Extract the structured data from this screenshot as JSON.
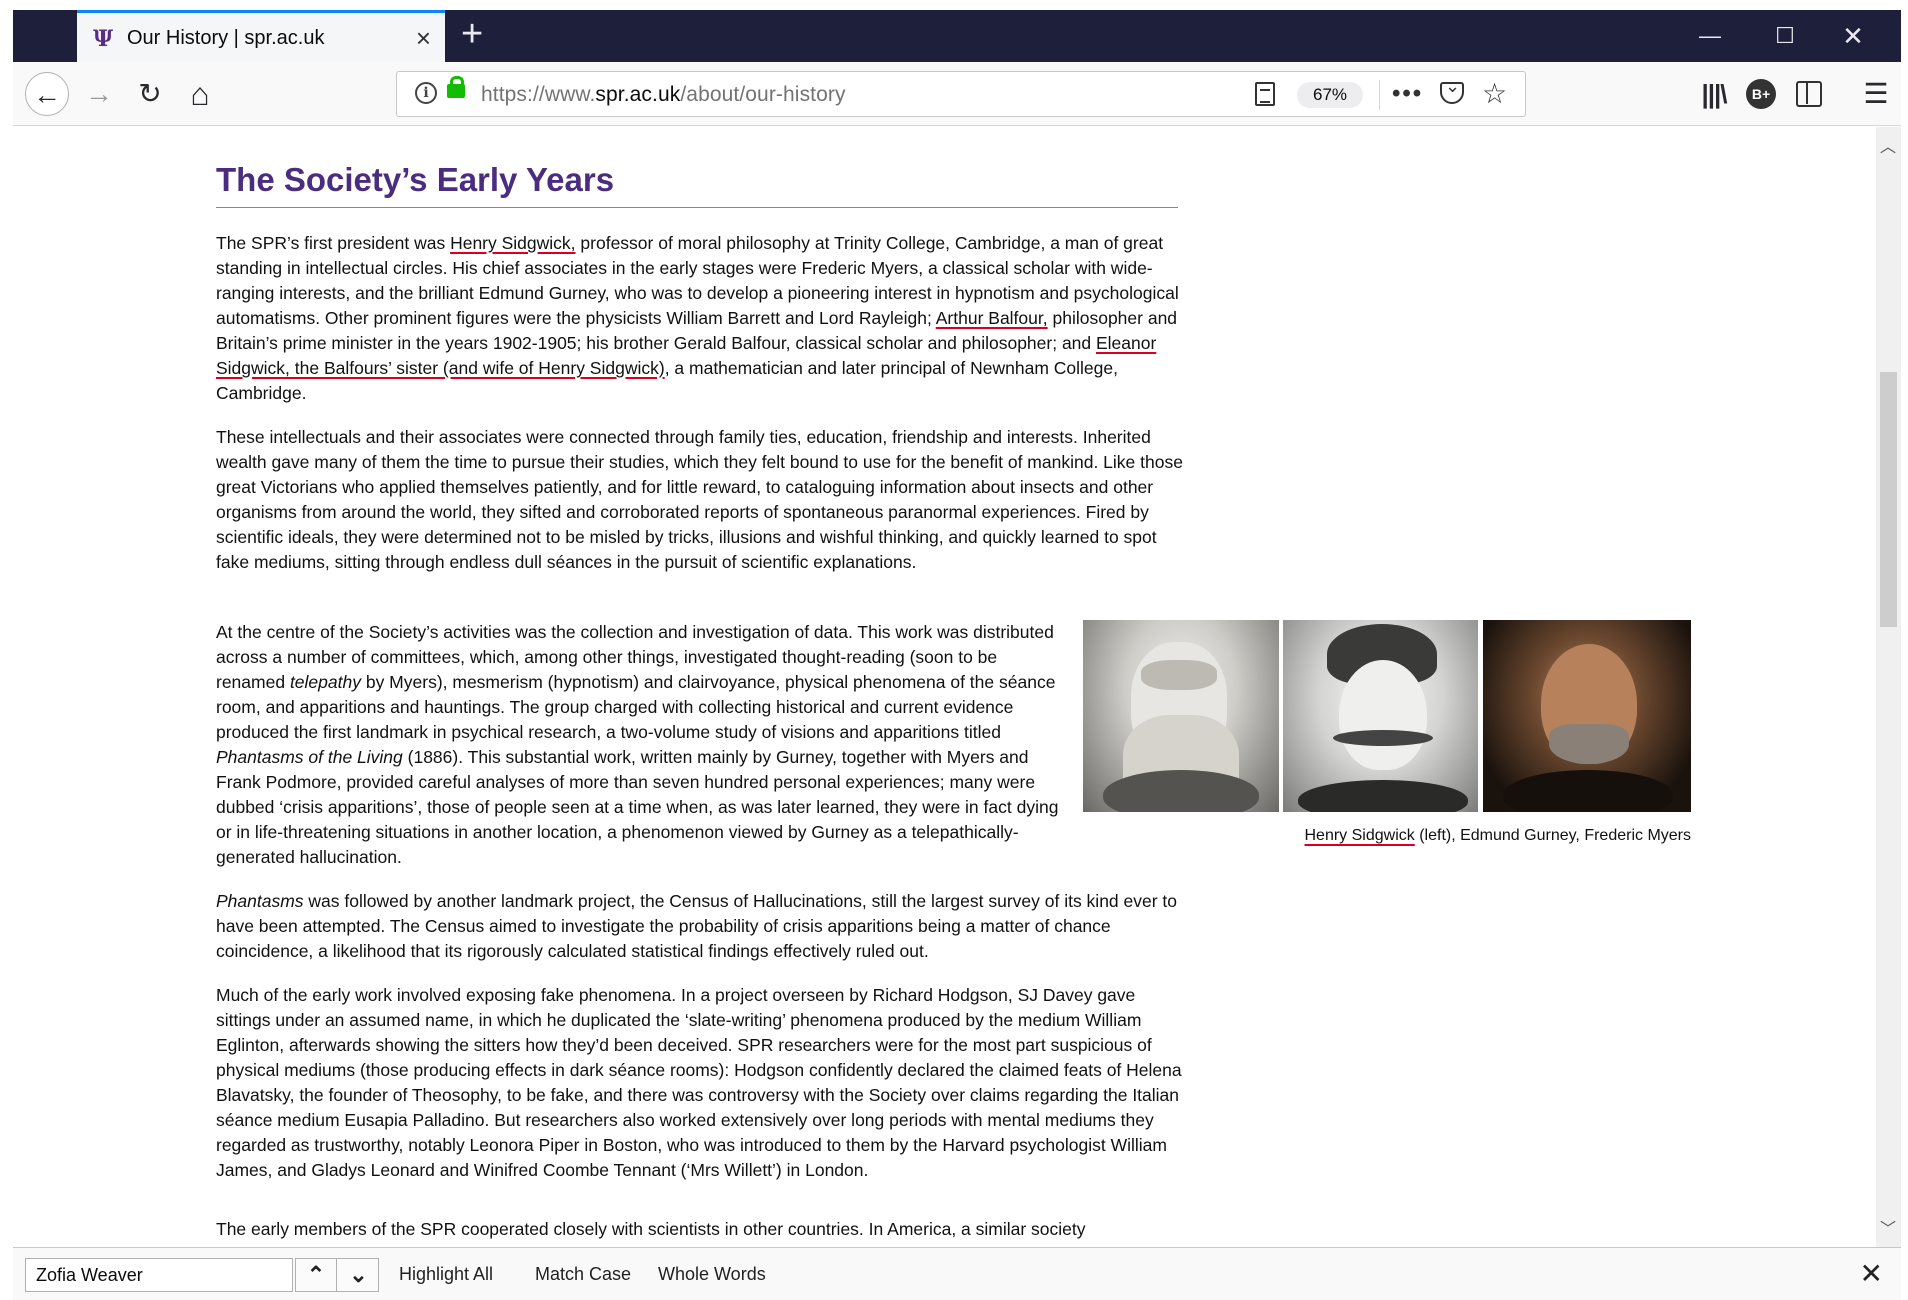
{
  "browser": {
    "tab": {
      "title": "Our History | spr.ac.uk",
      "favicon": "spr-psi-logo"
    },
    "window_controls": {
      "minimize": "—",
      "maximize": "☐",
      "close": "✕"
    },
    "nav": {
      "back": "←",
      "forward": "→",
      "reload": "↻",
      "home": "⌂"
    },
    "url": {
      "prefix": "https://www.",
      "domain": "spr.ac.uk",
      "path": "/about/our-history"
    },
    "zoom": "67%",
    "page_actions": "•••",
    "star": "☆",
    "toolbar": {
      "library": "|||\\",
      "extension": "B+",
      "menu": "☰"
    }
  },
  "article": {
    "heading": "The Society’s Early Years",
    "p1": {
      "t1": "The SPR’s first president was ",
      "link1": "Henry Sidgwick,",
      "t2": " professor of moral philosophy at Trinity College, Cambridge, a man of great standing in intellectual circles. His chief associates in the early stages were Frederic Myers, a classical scholar with wide-ranging interests, and the brilliant Edmund Gurney, who was to develop a pioneering interest in hypnotism and psychological automatisms.  Other prominent figures were the physicists William Barrett and Lord Rayleigh; ",
      "link2": "Arthur Balfour,",
      "t3": " philosopher and Britain’s prime minister in the years 1902-1905; his brother Gerald Balfour, classical scholar and philosopher; and ",
      "link3": "Eleanor Sidgwick, the Balfours’ sister (and wife of Henry Sidgwick)",
      "t4": ", a mathematician and later principal of Newnham College, Cambridge."
    },
    "p2": "These intellectuals and their associates were connected through family ties, education, friendship and interests. Inherited wealth gave many of them the time to pursue their studies, which they felt bound to use for the benefit of mankind. Like those great Victorians who applied themselves patiently, and for little reward, to cataloguing information about insects and other organisms from around the world, they sifted and corroborated reports of spontaneous paranormal experiences. Fired by scientific ideals, they were determined not to be misled by tricks, illusions and wishful thinking, and quickly learned to spot fake mediums, sitting through endless dull séances in the pursuit of scientific explanations.",
    "p3": {
      "t1": "At the centre of the Society’s activities was the collection and investigation of data. This work was distributed across a number of committees, which, among other things, investigated thought-reading (soon to be renamed ",
      "em1": "telepathy",
      "t2": " by Myers), mesmerism (hypnotism) and clairvoyance, physical phenomena of the séance room, and apparitions and hauntings. The group charged with collecting historical and current evidence produced the first landmark in psychical research, a two-volume study of visions and apparitions titled ",
      "em2": "Phantasms of the Living",
      "t3": " (1886). This substantial work, written mainly by Gurney, together with Myers and Frank Podmore, provided careful analyses of more than seven hundred personal experiences; many were dubbed ‘crisis apparitions’, those of people seen at a time when, as was later learned, they were in fact dying or in life-threatening situations in another location, a phenomenon viewed by Gurney as a telepathically-generated hallucination."
    },
    "p4": {
      "em1": "Phantasms",
      "t1": " was followed by another landmark project, the Census of Hallucinations, still the largest survey of its kind ever to have been attempted. The Census aimed to investigate the probability of crisis apparitions being a matter of chance coincidence, a likelihood that its rigorously calculated statistical findings effectively ruled out."
    },
    "p5": "Much of the early work involved exposing fake phenomena. In a project overseen by Richard Hodgson, SJ Davey gave sittings under an assumed name, in which he duplicated the ‘slate-writing’ phenomena produced by the medium William Eglinton, afterwards showing the sitters how they’d been deceived. SPR researchers were for the most part suspicious of physical mediums (those producing effects in dark séance rooms): Hodgson confidently declared the claimed feats of Helena Blavatsky, the founder of Theosophy, to be fake, and there was controversy with the Society over claims regarding the Italian séance medium Eusapia Palladino. But researchers also worked extensively over long periods with mental mediums they regarded as trustworthy, notably Leonora Piper in Boston, who was introduced to them by the Harvard psychologist William James, and Gladys Leonard and Winifred Coombe Tennant (‘Mrs Willett’) in London.",
    "p6": "The early members of the SPR cooperated closely with scientists in other countries. In America, a similar society",
    "caption": {
      "link": "Henry Sidgwick",
      "rest": " (left), Edmund Gurney, Frederic Myers"
    }
  },
  "findbar": {
    "query": "Zofia Weaver",
    "prev": "⌃",
    "next": "⌄",
    "highlight_all": "Highlight All",
    "match_case": "Match Case",
    "whole_words": "Whole Words",
    "close": "✕"
  }
}
